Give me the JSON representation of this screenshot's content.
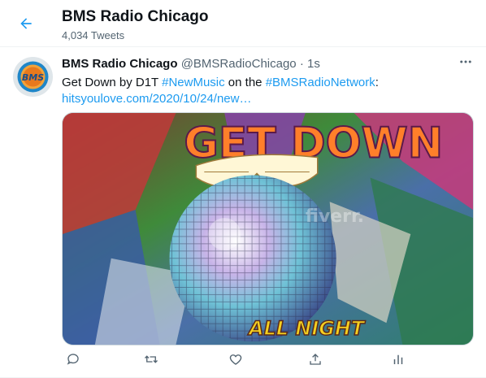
{
  "header": {
    "title": "BMS Radio Chicago",
    "subtitle": "4,034 Tweets"
  },
  "tweet": {
    "author_name": "BMS Radio Chicago",
    "author_handle": "@BMSRadioChicago",
    "separator": "·",
    "time": "1s",
    "avatar_text": "BMS",
    "text_prefix": "Get Down by D1T ",
    "hashtag_1": "#NewMusic",
    "text_middle": " on the ",
    "hashtag_2": "#BMSRadioNetwork",
    "text_suffix": ":",
    "url": "hitsyoulove.com/2020/10/24/new…",
    "media": {
      "top_text": "GET DOWN",
      "bottom_text": "ALL NIGHT",
      "watermark": "fiverr."
    }
  },
  "icons": {
    "back": "arrow-left-icon",
    "more": "more-horizontal-icon",
    "reply": "reply-icon",
    "retweet": "retweet-icon",
    "like": "heart-icon",
    "share": "share-icon",
    "analytics": "analytics-icon"
  },
  "colors": {
    "accent": "#1d9bf0",
    "text": "#0f1419",
    "muted": "#536471"
  }
}
